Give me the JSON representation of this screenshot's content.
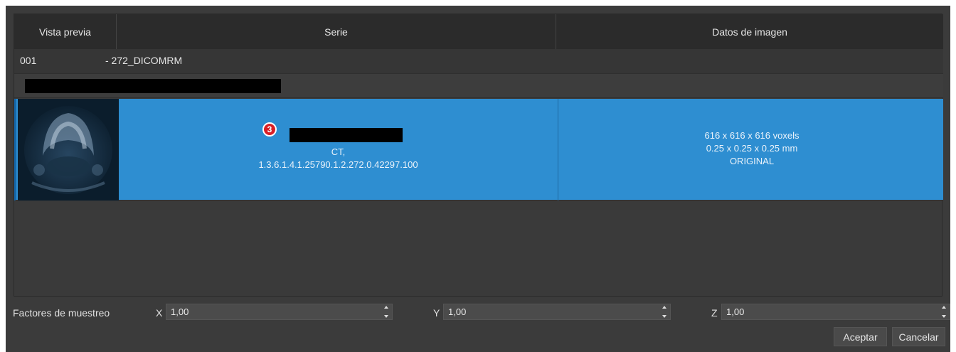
{
  "table": {
    "headers": {
      "preview": "Vista previa",
      "series": "Serie",
      "image_data": "Datos de imagen"
    },
    "group": {
      "number": "001",
      "name": "- 272_DICOMRM"
    },
    "selected_row": {
      "badge": "3",
      "modality": "CT,",
      "uid": "1.3.6.1.4.1.25790.1.2.272.0.42297.100",
      "dimensions": "616 x 616 x 616 voxels",
      "spacing": "0.25 x 0.25 x 0.25 mm",
      "type": "ORIGINAL"
    }
  },
  "sampling": {
    "label": "Factores de muestreo",
    "x_label": "X",
    "x_value": "1,00",
    "y_label": "Y",
    "y_value": "1,00",
    "z_label": "Z",
    "z_value": "1,00"
  },
  "buttons": {
    "accept": "Aceptar",
    "cancel": "Cancelar"
  },
  "colors": {
    "selection": "#2e8ed1",
    "badge": "#d91f26",
    "dialog_bg": "#3b3b3b"
  }
}
